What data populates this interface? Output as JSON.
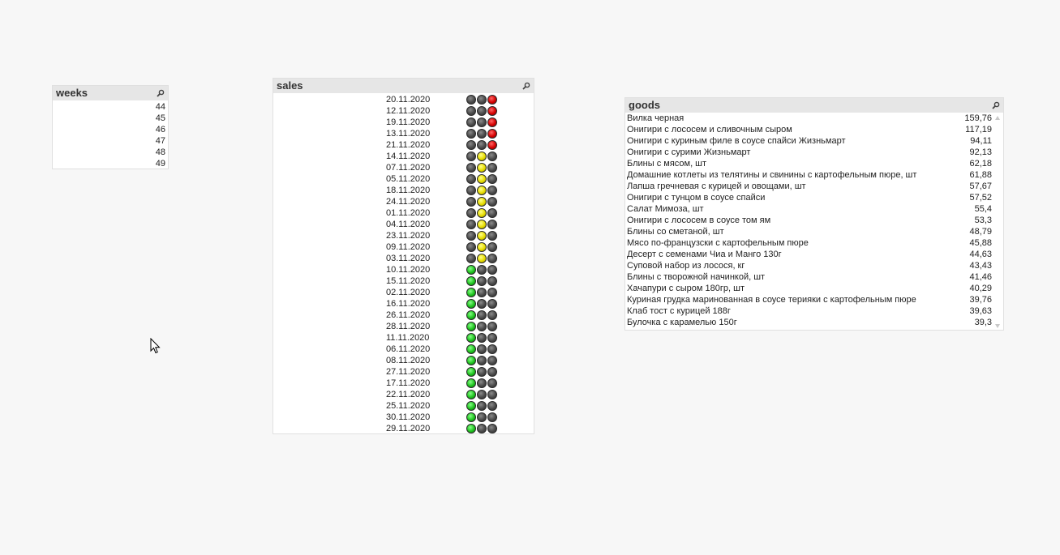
{
  "weeks": {
    "title": "weeks",
    "values": [
      "44",
      "45",
      "46",
      "47",
      "48",
      "49"
    ]
  },
  "sales": {
    "title": "sales",
    "rows": [
      {
        "date": "20.11.2020",
        "light": "red"
      },
      {
        "date": "12.11.2020",
        "light": "red"
      },
      {
        "date": "19.11.2020",
        "light": "red"
      },
      {
        "date": "13.11.2020",
        "light": "red"
      },
      {
        "date": "21.11.2020",
        "light": "red"
      },
      {
        "date": "14.11.2020",
        "light": "yellow"
      },
      {
        "date": "07.11.2020",
        "light": "yellow"
      },
      {
        "date": "05.11.2020",
        "light": "yellow"
      },
      {
        "date": "18.11.2020",
        "light": "yellow"
      },
      {
        "date": "24.11.2020",
        "light": "yellow"
      },
      {
        "date": "01.11.2020",
        "light": "yellow"
      },
      {
        "date": "04.11.2020",
        "light": "yellow"
      },
      {
        "date": "23.11.2020",
        "light": "yellow"
      },
      {
        "date": "09.11.2020",
        "light": "yellow"
      },
      {
        "date": "03.11.2020",
        "light": "yellow"
      },
      {
        "date": "10.11.2020",
        "light": "green"
      },
      {
        "date": "15.11.2020",
        "light": "green"
      },
      {
        "date": "02.11.2020",
        "light": "green"
      },
      {
        "date": "16.11.2020",
        "light": "green"
      },
      {
        "date": "26.11.2020",
        "light": "green"
      },
      {
        "date": "28.11.2020",
        "light": "green"
      },
      {
        "date": "11.11.2020",
        "light": "green"
      },
      {
        "date": "06.11.2020",
        "light": "green"
      },
      {
        "date": "08.11.2020",
        "light": "green"
      },
      {
        "date": "27.11.2020",
        "light": "green"
      },
      {
        "date": "17.11.2020",
        "light": "green"
      },
      {
        "date": "22.11.2020",
        "light": "green"
      },
      {
        "date": "25.11.2020",
        "light": "green"
      },
      {
        "date": "30.11.2020",
        "light": "green"
      },
      {
        "date": "29.11.2020",
        "light": "green"
      }
    ]
  },
  "goods": {
    "title": "goods",
    "rows": [
      {
        "name": "Вилка черная",
        "value": "159,76"
      },
      {
        "name": "Онигири с лососем и сливочным сыром",
        "value": "117,19"
      },
      {
        "name": "Онигири с куриным филе в соусе спайси Жизньмарт",
        "value": "94,11"
      },
      {
        "name": "Онигири с сурими  Жизньмарт",
        "value": "92,13"
      },
      {
        "name": "Блины с мясом, шт",
        "value": "62,18"
      },
      {
        "name": "Домашние котлеты из телятины и свинины с картофельным пюре, шт",
        "value": "61,88"
      },
      {
        "name": "Лапша гречневая с курицей и овощами, шт",
        "value": "57,67"
      },
      {
        "name": "Онигири с тунцом в соусе спайси",
        "value": "57,52"
      },
      {
        "name": "Салат Мимоза, шт",
        "value": "55,4"
      },
      {
        "name": "Онигири с лососем в соусе том ям",
        "value": "53,3"
      },
      {
        "name": "Блины со сметаной, шт",
        "value": "48,79"
      },
      {
        "name": "Мясо по-французски с картофельным пюре",
        "value": "45,88"
      },
      {
        "name": "Десерт с семенами Чиа и Манго 130г",
        "value": "44,63"
      },
      {
        "name": "Суповой набор из лосося, кг",
        "value": "43,43"
      },
      {
        "name": "Блины с творожной начинкой, шт",
        "value": "41,46"
      },
      {
        "name": "Хачапури с сыром 180гр, шт",
        "value": "40,29"
      },
      {
        "name": "Куриная грудка маринованная в соусе терияки с картофельным пюре",
        "value": "39,76"
      },
      {
        "name": "Клаб тост с курицей 188г",
        "value": "39,63"
      },
      {
        "name": "Булочка с карамелью 150г",
        "value": "39,3"
      }
    ]
  },
  "icons": {
    "search": "search-icon",
    "cursor": "mouse-pointer-icon"
  }
}
